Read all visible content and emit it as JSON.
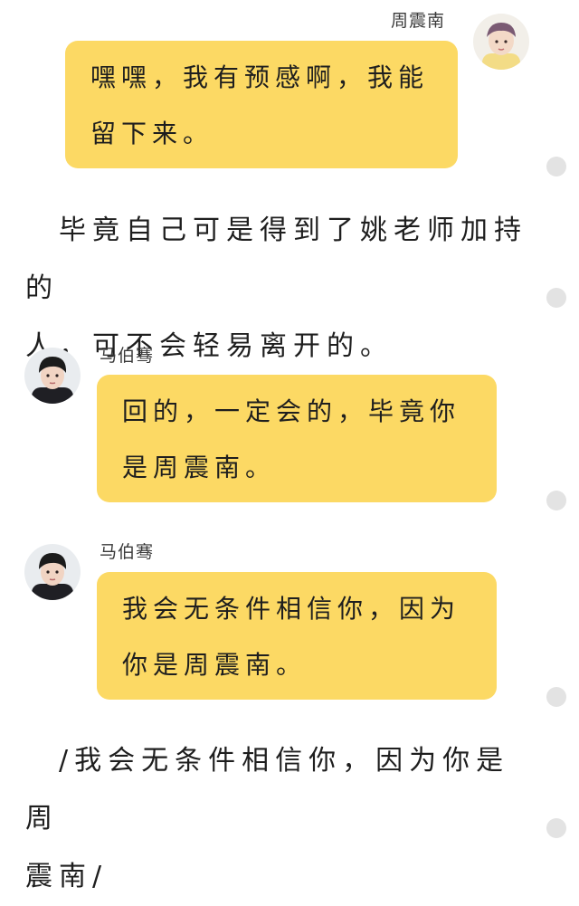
{
  "colors": {
    "bubble": "#fcd964",
    "dot": "#e3e3e3",
    "text": "#1e1e1e"
  },
  "messages": [
    {
      "side": "right",
      "speaker": "周震南",
      "avatar_icon": "avatar-photo-icon",
      "lines": [
        "嘿嘿，我有预感啊，我能",
        "留下来。"
      ]
    },
    {
      "side": "left",
      "speaker": "马伯骞",
      "avatar_icon": "avatar-photo-icon",
      "lines": [
        "回的，一定会的，毕竟你",
        "是周震南。"
      ]
    },
    {
      "side": "left",
      "speaker": "马伯骞",
      "avatar_icon": "avatar-photo-icon",
      "lines": [
        "我会无条件相信你，因为",
        "你是周震南。"
      ]
    }
  ],
  "narrations": [
    {
      "lines": [
        "　毕竟自己可是得到了姚老师加持的",
        "人，可不会轻易离开的。"
      ]
    },
    {
      "lines": [
        "　/我会无条件相信你，因为你是周",
        "震南/"
      ]
    }
  ],
  "side_dots_icon": "page-dot-icon"
}
